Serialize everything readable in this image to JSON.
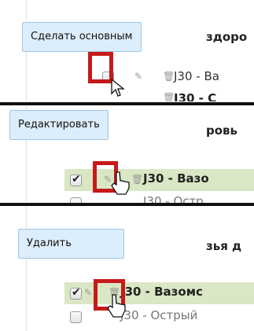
{
  "panels": [
    {
      "tooltip": "Сделать основным",
      "background_heading": "здоро",
      "rows": [
        {
          "checked": false,
          "code": "J30 - Ва"
        },
        {
          "checked": false,
          "code": "J30 - С"
        }
      ],
      "highlighted_control": "checkbox"
    },
    {
      "tooltip": "Редактировать",
      "background_heading": "ровь",
      "rows": [
        {
          "checked": true,
          "code": "J30 - Вазо"
        },
        {
          "checked": false,
          "code": "J30 - Остр"
        }
      ],
      "highlighted_control": "edit"
    },
    {
      "tooltip": "Удалить",
      "background_heading": "зья д",
      "rows": [
        {
          "checked": true,
          "code": "J30 - Вазомс"
        },
        {
          "checked": false,
          "code": "J30 - Острый"
        }
      ],
      "highlighted_control": "delete"
    }
  ],
  "colors": {
    "highlight_frame": "#c61a1a",
    "tooltip_bg": "#dcedfb",
    "selected_row_bg": "#d9e7c4"
  },
  "icons": {
    "edit": "pencil-icon",
    "delete": "trash-icon",
    "cursor": "mouse-pointer-icon"
  }
}
